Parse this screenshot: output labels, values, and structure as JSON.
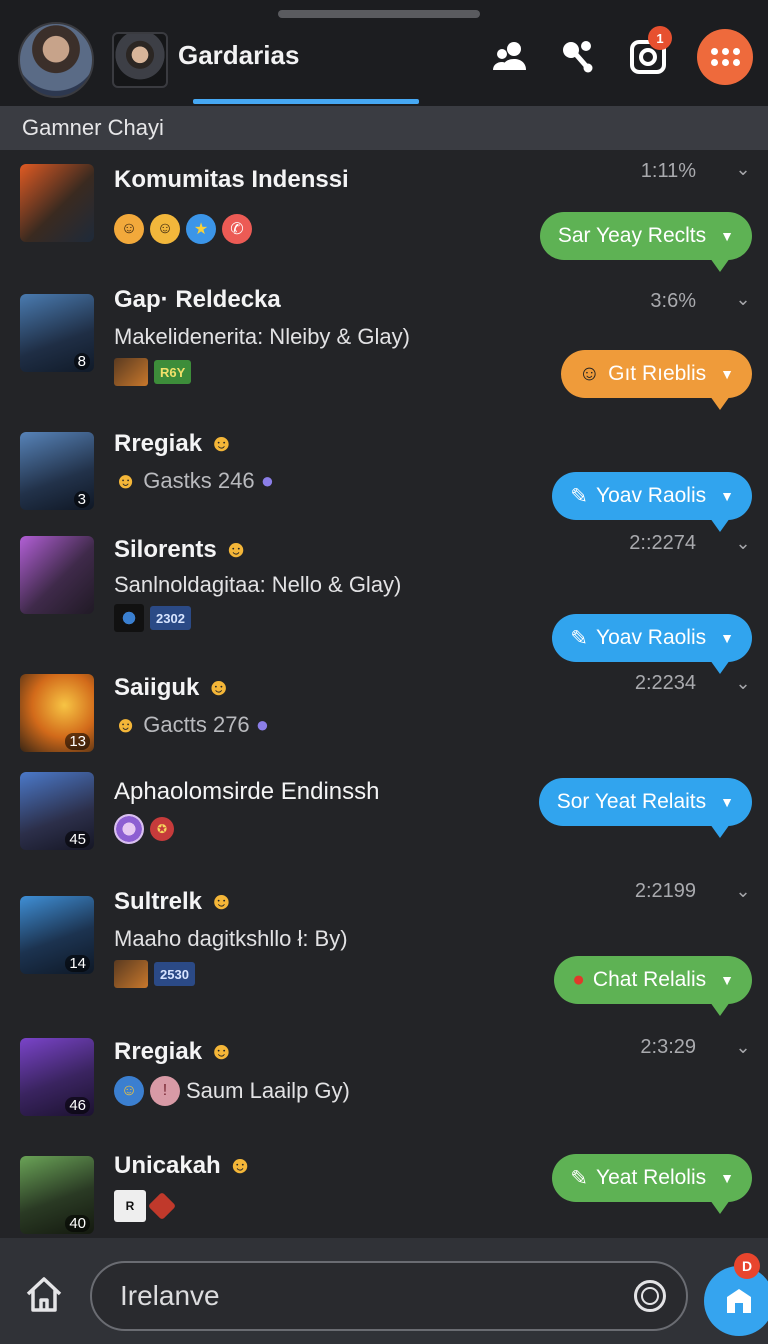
{
  "header": {
    "title": "Gardarias",
    "notification_count": "1",
    "icons": [
      "contacts-icon",
      "share-icon",
      "camera-icon",
      "menu-grid-icon"
    ]
  },
  "subheader": {
    "label": "Gamner Chayi"
  },
  "chats": [
    {
      "name": "Komumitas Indenssi",
      "time": "1:11%",
      "reply": "Sar Yeay Reclts",
      "bubble_color": "#5eb254"
    },
    {
      "name": "Gap· Reldecka",
      "subtitle": "Makelidenerita: Nleiby & Glay)",
      "time": "3:6%",
      "badge": "8",
      "tag": "R6Y",
      "reply": "Gıt Rıeblis",
      "bubble_color": "#ef9b3a"
    },
    {
      "name": "Rregiak",
      "subtitle": "Gastks 246",
      "badge": "3",
      "reply": "Yoav Raolis",
      "bubble_color": "#31a4ee"
    },
    {
      "name": "Silorents",
      "subtitle": "Sanlnoldagitaa: Nello & Glay)",
      "time": "2::2274",
      "tag": "2302",
      "reply": "Yoav Raolis",
      "bubble_color": "#31a4ee"
    },
    {
      "name": "Saiiguk",
      "subtitle": "Gactts 276",
      "time": "2:2234",
      "badge": "13"
    },
    {
      "name": "Aphaolomsirde Endinssh",
      "badge": "45",
      "reply": "Sor Yeat Relaits",
      "bubble_color": "#31a4ee"
    },
    {
      "name": "Sultrelk",
      "subtitle": "Maaho dagitkshllo ł: By)",
      "time": "2:2199",
      "badge": "14",
      "tag": "2530",
      "reply": "Chat Relalis",
      "bubble_color": "#5eb254"
    },
    {
      "name": "Rregiak",
      "subtitle": "Saum Laailp Gy)",
      "time": "2:3:29",
      "badge": "46"
    },
    {
      "name": "Unicakah",
      "badge": "40",
      "reply": "Yeat Relolis",
      "bubble_color": "#5eb254"
    }
  ],
  "composer": {
    "placeholder": "Irelanve"
  },
  "fab": {
    "badge": "D"
  }
}
